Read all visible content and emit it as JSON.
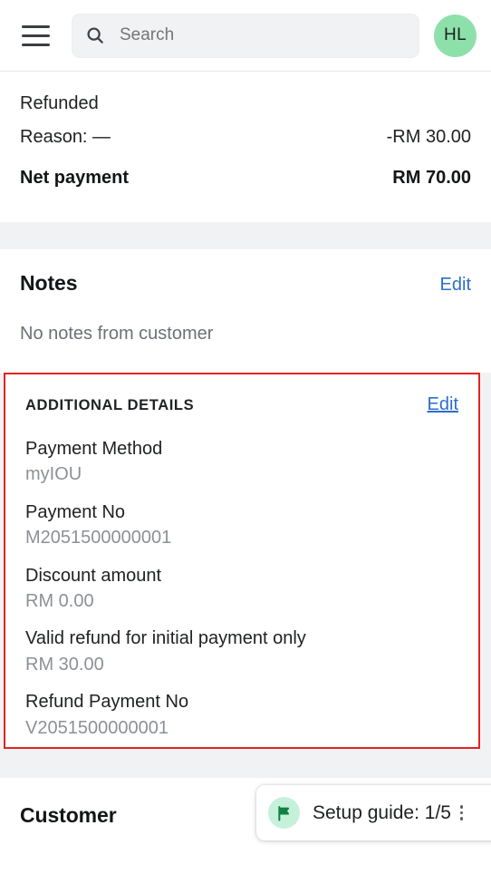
{
  "header": {
    "menu_icon": "hamburger-menu-icon",
    "search": {
      "icon": "search-icon",
      "placeholder": "Search",
      "value": ""
    },
    "avatar": {
      "initials": "HL",
      "background": "#8ee0ab"
    }
  },
  "payment_summary": {
    "status_label": "Refunded",
    "reason_label": "Reason: —",
    "reason_amount": "-RM 30.00",
    "net_label": "Net payment",
    "net_amount": "RM 70.00"
  },
  "notes": {
    "title": "Notes",
    "edit_label": "Edit",
    "empty_text": "No notes from customer"
  },
  "additional_details": {
    "title": "ADDITIONAL DETAILS",
    "edit_label": "Edit",
    "highlight_color": "#e52322",
    "items": [
      {
        "label": "Payment Method",
        "value": "myIOU"
      },
      {
        "label": "Payment No",
        "value": "M2051500000001"
      },
      {
        "label": "Discount amount",
        "value": "RM 0.00"
      },
      {
        "label": "Valid refund for initial payment only",
        "value": "RM 30.00"
      },
      {
        "label": "Refund Payment No",
        "value": "V2051500000001"
      }
    ]
  },
  "customer": {
    "title": "Customer"
  },
  "setup_guide": {
    "icon": "flag-icon",
    "label": "Setup guide: 1/5",
    "menu_icon": "kebab-menu-icon",
    "icon_background": "#c5f0da",
    "icon_color": "#108043"
  },
  "link_color": "#2c6ecb"
}
